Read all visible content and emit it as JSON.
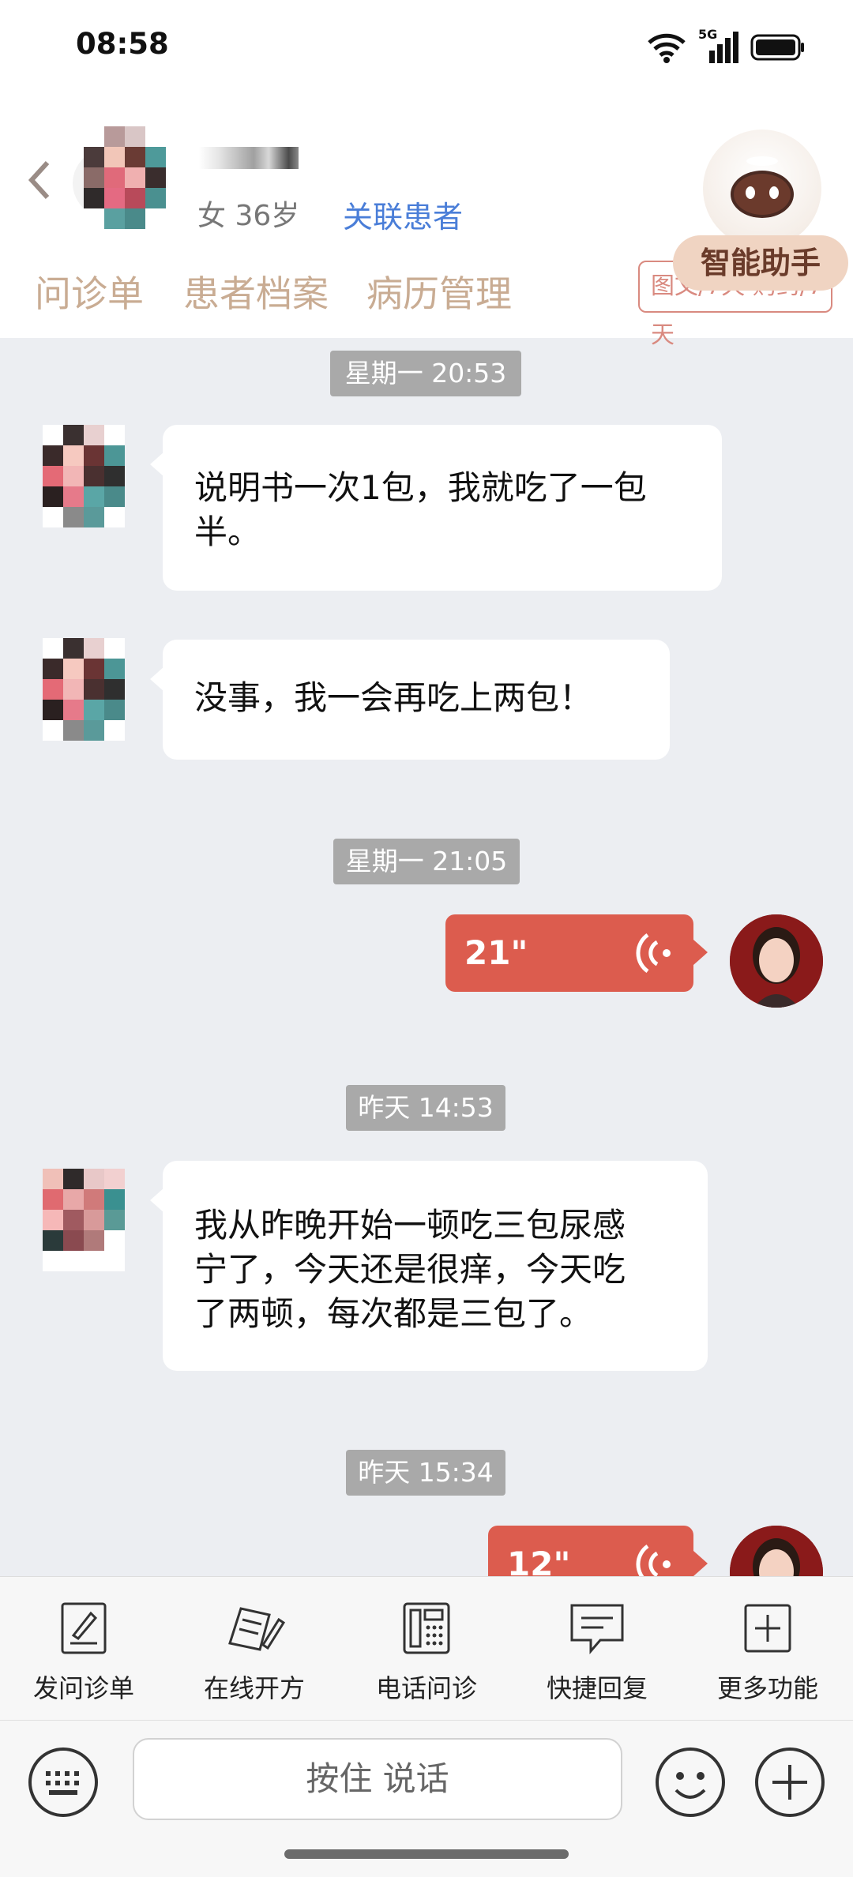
{
  "status_bar": {
    "time": "08:58",
    "network": "5G"
  },
  "header": {
    "back_icon": "chevron-left-icon",
    "patient_info": "女 36岁",
    "link_patient": "关联患者",
    "tabs": [
      {
        "label": "问诊单"
      },
      {
        "label": "患者档案"
      },
      {
        "label": "病历管理"
      }
    ],
    "tab_box_label": "图文/7天 购药/7天",
    "assistant": {
      "label": "智能助手"
    }
  },
  "messages": [
    {
      "type": "timestamp",
      "text": "星期一 20:53"
    },
    {
      "type": "text",
      "from": "patient",
      "lines": [
        "说明书一次1包，我就吃了一包",
        "半。"
      ]
    },
    {
      "type": "text",
      "from": "patient",
      "lines": [
        "没事，我一会再吃上两包！"
      ]
    },
    {
      "type": "timestamp",
      "text": "星期一 21:05"
    },
    {
      "type": "voice",
      "from": "doctor",
      "duration": "21\""
    },
    {
      "type": "timestamp",
      "text": "昨天 14:53"
    },
    {
      "type": "text",
      "from": "patient",
      "lines": [
        "我从昨晚开始一顿吃三包尿感",
        "宁了，今天还是很痒，今天吃",
        "了两顿，每次都是三包了。"
      ]
    },
    {
      "type": "timestamp",
      "text": "昨天 15:34"
    },
    {
      "type": "voice",
      "from": "doctor",
      "duration": "12\""
    }
  ],
  "toolbar": {
    "items": [
      {
        "label": "发问诊单",
        "icon": "form-edit-icon"
      },
      {
        "label": "在线开方",
        "icon": "prescription-icon"
      },
      {
        "label": "电话问诊",
        "icon": "phone-icon"
      },
      {
        "label": "快捷回复",
        "icon": "chat-bubble-icon"
      },
      {
        "label": "更多功能",
        "icon": "plus-square-icon"
      }
    ]
  },
  "input_bar": {
    "hold_to_talk": "按住 说话"
  },
  "colors": {
    "accent_red": "#dc5c4e",
    "link_blue": "#4a7ed8",
    "tab_text": "#c9ac93"
  }
}
